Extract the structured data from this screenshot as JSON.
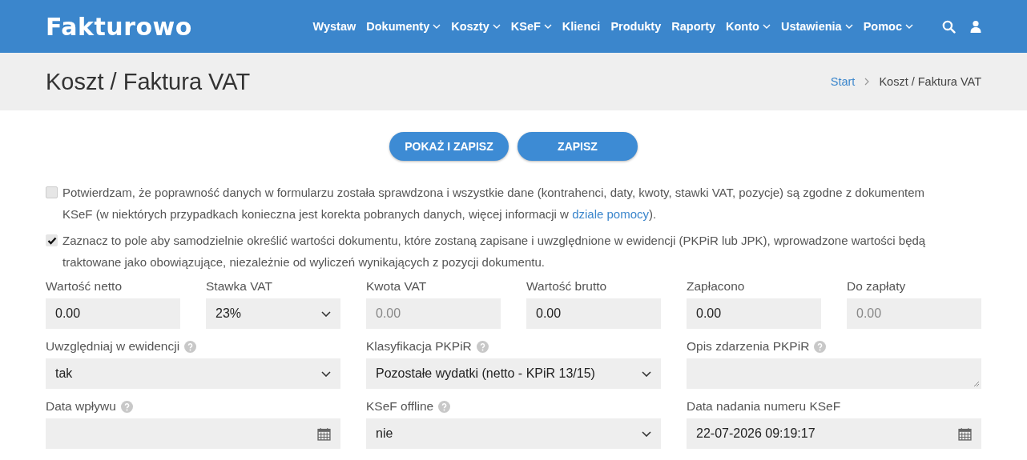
{
  "navbar": {
    "logo": "Fakturowo",
    "items": [
      {
        "label": "Wystaw",
        "dropdown": false
      },
      {
        "label": "Dokumenty",
        "dropdown": true
      },
      {
        "label": "Koszty",
        "dropdown": true
      },
      {
        "label": "KSeF",
        "dropdown": true
      },
      {
        "label": "Klienci",
        "dropdown": false
      },
      {
        "label": "Produkty",
        "dropdown": false
      },
      {
        "label": "Raporty",
        "dropdown": false
      },
      {
        "label": "Konto",
        "dropdown": true
      },
      {
        "label": "Ustawienia",
        "dropdown": true
      },
      {
        "label": "Pomoc",
        "dropdown": true
      }
    ]
  },
  "page_header": {
    "title": "Koszt / Faktura VAT",
    "breadcrumb": [
      {
        "label": "Start",
        "link": true
      },
      {
        "label": "Koszt / Faktura VAT",
        "link": false
      }
    ]
  },
  "buttons": [
    "POKAŻ I ZAPISZ",
    "ZAPISZ"
  ],
  "checkboxes": [
    {
      "checked": false,
      "before": "Potwierdzam, że poprawność danych w formularzu została sprawdzona i wszystkie dane (kontrahenci, daty, kwoty, stawki VAT, pozycje) są zgodne z dokumentem KSeF (w niektórych przypadkach konieczna jest korekta pobranych danych, więcej informacji w ",
      "link": "dziale pomocy",
      "after": ")."
    },
    {
      "checked": true,
      "before": "Zaznacz to pole aby samodzielnie określić wartości dokumentu, które zostaną zapisane i uwzględnione w ewidencji (PKPiR lub JPK), wprowadzone wartości będą traktowane jako obowiązujące, niezależnie od wyliczeń wynikających z pozycji dokumentu."
    }
  ],
  "fields": [
    {
      "label": "Wartość netto",
      "kind": "input",
      "wide": false,
      "help": false,
      "disabled": false,
      "value": "0.00"
    },
    {
      "label": "Stawka VAT",
      "kind": "select",
      "wide": false,
      "help": false,
      "disabled": false,
      "value": "23%"
    },
    {
      "label": "Kwota VAT",
      "kind": "input",
      "wide": false,
      "help": false,
      "disabled": true,
      "value": "0.00"
    },
    {
      "label": "Wartość brutto",
      "kind": "input",
      "wide": false,
      "help": false,
      "disabled": false,
      "value": "0.00"
    },
    {
      "label": "Zapłacono",
      "kind": "input",
      "wide": false,
      "help": false,
      "disabled": false,
      "value": "0.00"
    },
    {
      "label": "Do zapłaty",
      "kind": "input",
      "wide": false,
      "help": false,
      "disabled": true,
      "value": "0.00"
    },
    {
      "label": "Uwzględniaj w ewidencji",
      "kind": "select",
      "wide": true,
      "help": true,
      "disabled": false,
      "value": "tak"
    },
    {
      "label": "Klasyfikacja PKPiR",
      "kind": "select",
      "wide": true,
      "help": true,
      "disabled": false,
      "value": "Pozostałe wydatki (netto - KPiR 13/15)"
    },
    {
      "label": "Opis zdarzenia PKPiR",
      "kind": "textarea",
      "wide": true,
      "help": true,
      "disabled": false
    },
    {
      "label": "Data wpływu",
      "kind": "date",
      "wide": true,
      "help": true,
      "disabled": false
    },
    {
      "label": "KSeF offline",
      "kind": "select",
      "wide": true,
      "help": true,
      "disabled": false,
      "value": "nie"
    },
    {
      "label": "Data nadania numeru KSeF",
      "kind": "date",
      "wide": true,
      "help": false,
      "disabled": false,
      "value": "22-07-2026 09:19:17"
    }
  ]
}
